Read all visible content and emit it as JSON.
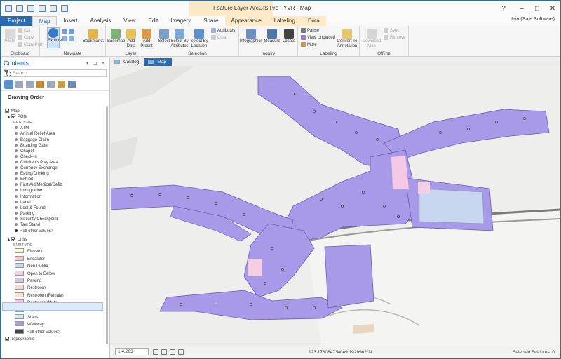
{
  "window": {
    "title": "ArcGIS Pro - YVR - Map",
    "context_title": "Feature Layer",
    "user": "Iain (Safe Software)",
    "help": "?"
  },
  "ribbon_tabs": [
    "Project",
    "Map",
    "Insert",
    "Analysis",
    "View",
    "Edit",
    "Imagery",
    "Share",
    "Appearance",
    "Labeling",
    "Data"
  ],
  "ribbon": {
    "clipboard": {
      "label": "Clipboard",
      "paste": "Paste",
      "cut": "Cut",
      "copy": "Copy",
      "copy_path": "Copy Path"
    },
    "navigate": {
      "label": "Navigate",
      "explore": "Explore",
      "bookmarks": "Bookmarks"
    },
    "layer": {
      "label": "Layer",
      "basemap": "Basemap",
      "add_data": "Add Data",
      "add_preset": "Add Preset"
    },
    "selection": {
      "label": "Selection",
      "select": "Select",
      "select_by_attributes": "Select By Attributes",
      "select_by_location": "Select By Location",
      "attributes": "Attributes",
      "clear": "Clear"
    },
    "inquiry": {
      "label": "Inquiry",
      "infographics": "Infographics",
      "measure": "Measure",
      "locate": "Locate"
    },
    "labeling": {
      "label": "Labeling",
      "pause": "Pause",
      "view_unplaced": "View Unplaced",
      "more": "More",
      "convert": "Convert To Annotation"
    },
    "offline": {
      "label": "Offline",
      "download": "Download Map",
      "sync": "Sync",
      "remove": "Remove"
    }
  },
  "contents": {
    "title": "Contents",
    "search_placeholder": "Search",
    "drawing_order": "Drawing Order",
    "map_label": "Map",
    "pois_label": "POIs",
    "feature_header": "FEATURE",
    "poi_items": [
      "ATM",
      "Animal Relief Area",
      "Baggage Claim",
      "Boarding Gate",
      "Chapel",
      "Check-in",
      "Children's Play Area",
      "Currency Exchange",
      "Eating/Drinking",
      "Exhibit",
      "First Aid/Medical/Defib",
      "Immigration",
      "Information",
      "Label",
      "Lost & Found",
      "Parking",
      "Security Checkpoint",
      "Taxi Stand"
    ],
    "poi_other": "<all other values>",
    "units_label": "Units",
    "subtype_header": "SUBTYPE",
    "unit_items": [
      {
        "label": "Elevator",
        "color": "#fdf6cf"
      },
      {
        "label": "Escalator",
        "color": "#f7c9cf"
      },
      {
        "label": "Non-Public",
        "color": "#c8d6f0"
      },
      {
        "label": "Open to Below",
        "color": "#f3cfe3"
      },
      {
        "label": "Parking",
        "color": "#d6bff0"
      },
      {
        "label": "Restroom",
        "color": "#f6d7d7"
      },
      {
        "label": "Restroom (Female)",
        "color": "#fbe3d4"
      },
      {
        "label": "Restroom (Male)",
        "color": "#f5c8e6"
      },
      {
        "label": "Room",
        "color": "#c9dcf5"
      },
      {
        "label": "Stairs",
        "color": "#d3ecef"
      },
      {
        "label": "Walkway",
        "color": "#a89ae8"
      }
    ],
    "unit_other": "<all other values>",
    "topographic_label": "Topographic"
  },
  "doc_tabs": [
    {
      "label": "Catalog",
      "active": false
    },
    {
      "label": "Map",
      "active": true
    }
  ],
  "status": {
    "scale": "1:4,203",
    "coordinates": "123.1780847°W 49.1929962°N",
    "selected": "Selected Features: 0"
  },
  "colors": {
    "accent": "#2b6cb0",
    "walkway": "#a89ae8",
    "nonpublic": "#c8d6f0"
  }
}
